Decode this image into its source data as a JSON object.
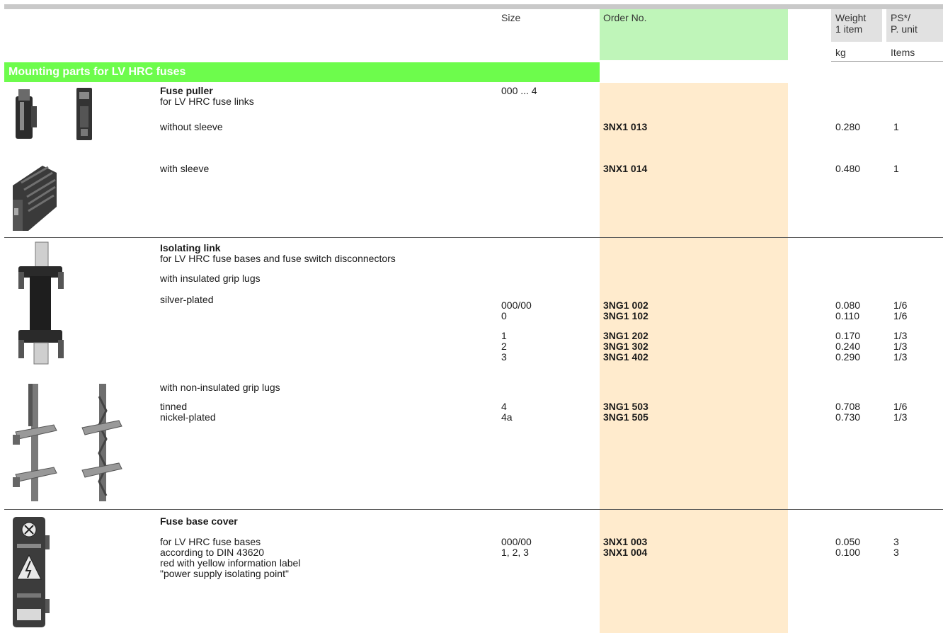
{
  "header": {
    "size": "Size",
    "order_no": "Order No.",
    "weight": "Weight",
    "weight_sub": "1 item",
    "ps": "PS*/",
    "ps_sub": "P. unit",
    "unit_kg": "kg",
    "unit_items": "Items"
  },
  "section": {
    "title": "Mounting parts for LV HRC fuses"
  },
  "fuse_puller": {
    "title": "Fuse puller",
    "subtitle": "for LV HRC fuse links",
    "size": "000 ... 4",
    "rows": [
      {
        "desc": "without sleeve",
        "order": "3NX1 013",
        "weight": "0.280",
        "ps": "1"
      },
      {
        "desc": "with sleeve",
        "order": "3NX1 014",
        "weight": "0.480",
        "ps": "1"
      }
    ]
  },
  "isolating_link": {
    "title": "Isolating link",
    "subtitle": "for LV HRC fuse bases and fuse switch disconnectors",
    "insulated_label": "with insulated grip lugs",
    "silver_label": "silver-plated",
    "insulated_rows": [
      {
        "size": "000/00",
        "order": "3NG1 002",
        "weight": "0.080",
        "ps": "1/6"
      },
      {
        "size": "0",
        "order": "3NG1 102",
        "weight": "0.110",
        "ps": "1/6"
      },
      {
        "size": "1",
        "order": "3NG1 202",
        "weight": "0.170",
        "ps": "1/3"
      },
      {
        "size": "2",
        "order": "3NG1 302",
        "weight": "0.240",
        "ps": "1/3"
      },
      {
        "size": "3",
        "order": "3NG1 402",
        "weight": "0.290",
        "ps": "1/3"
      }
    ],
    "noninsulated_label": "with non-insulated grip lugs",
    "noninsulated_rows": [
      {
        "desc": "tinned",
        "size": "4",
        "order": "3NG1 503",
        "weight": "0.708",
        "ps": "1/6"
      },
      {
        "desc": "nickel-plated",
        "size": "4a",
        "order": "3NG1 505",
        "weight": "0.730",
        "ps": "1/3"
      }
    ]
  },
  "fuse_base_cover": {
    "title": "Fuse base cover",
    "desc_lines": [
      "for LV HRC fuse bases",
      "according to DIN 43620",
      "red with yellow information label",
      "\"power supply isolating point\""
    ],
    "rows": [
      {
        "size": "000/00",
        "order": "3NX1 003",
        "weight": "0.050",
        "ps": "3"
      },
      {
        "size": "1, 2, 3",
        "order": "3NX1 004",
        "weight": "0.100",
        "ps": "3"
      }
    ]
  }
}
